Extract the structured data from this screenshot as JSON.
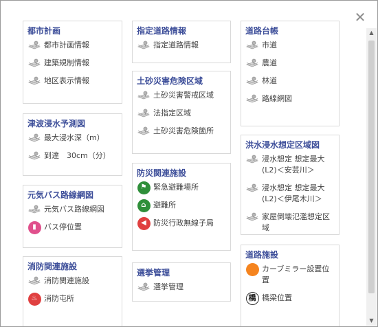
{
  "close_label": "✕",
  "colors": {
    "title": "#3e4f9a",
    "border": "#d9d9d9"
  },
  "panels": {
    "toshi": {
      "title": "都市計画",
      "items": [
        "都市計画情報",
        "建築規制情報",
        "地区表示情報"
      ]
    },
    "tsunami": {
      "title": "津波浸水予測図",
      "items": [
        "最大浸水深（m）",
        "到達　30cm（分）"
      ]
    },
    "bus": {
      "title": "元気バス路線網図",
      "items": [
        "元気バス路線網図",
        "バス停位置"
      ]
    },
    "shobo": {
      "title": "消防関連施設",
      "items": [
        "消防関連施設",
        "消防屯所"
      ]
    },
    "shitei": {
      "title": "指定道路情報",
      "items": [
        "指定道路情報"
      ]
    },
    "dosha": {
      "title": "土砂災害危険区域",
      "items": [
        "土砂災害警戒区域",
        "法指定区域",
        "土砂災害危険箇所"
      ]
    },
    "bosai": {
      "title": "防災関連施設",
      "items": [
        "緊急避難場所",
        "避難所",
        "防災行政無線子局"
      ]
    },
    "senkyo": {
      "title": "選挙管理",
      "items": [
        "選挙管理"
      ]
    },
    "daicho": {
      "title": "道路台帳",
      "items": [
        "市道",
        "農道",
        "林道",
        "路線網図"
      ]
    },
    "kozui": {
      "title": "洪水浸水想定区域図",
      "items": [
        "浸水想定 想定最大(L2)＜安芸川＞",
        "浸水想定 想定最大(L2)＜伊尾木川＞",
        "家屋倒壊氾濫想定区域"
      ]
    },
    "doro": {
      "title": "道路施設",
      "items": [
        "カーブミラー設置位置",
        "橋梁位置"
      ]
    }
  },
  "icons": {
    "map_layer": "map-layer-icon",
    "evacuation": "evacuation-site-icon",
    "shelter": "shelter-icon",
    "radio": "radio-speaker-icon",
    "bus_stop": "bus-stop-icon",
    "fire_station": "fire-station-icon",
    "mirror": "curve-mirror-icon",
    "bridge": "bridge-icon",
    "bridge_glyph": "橋"
  }
}
